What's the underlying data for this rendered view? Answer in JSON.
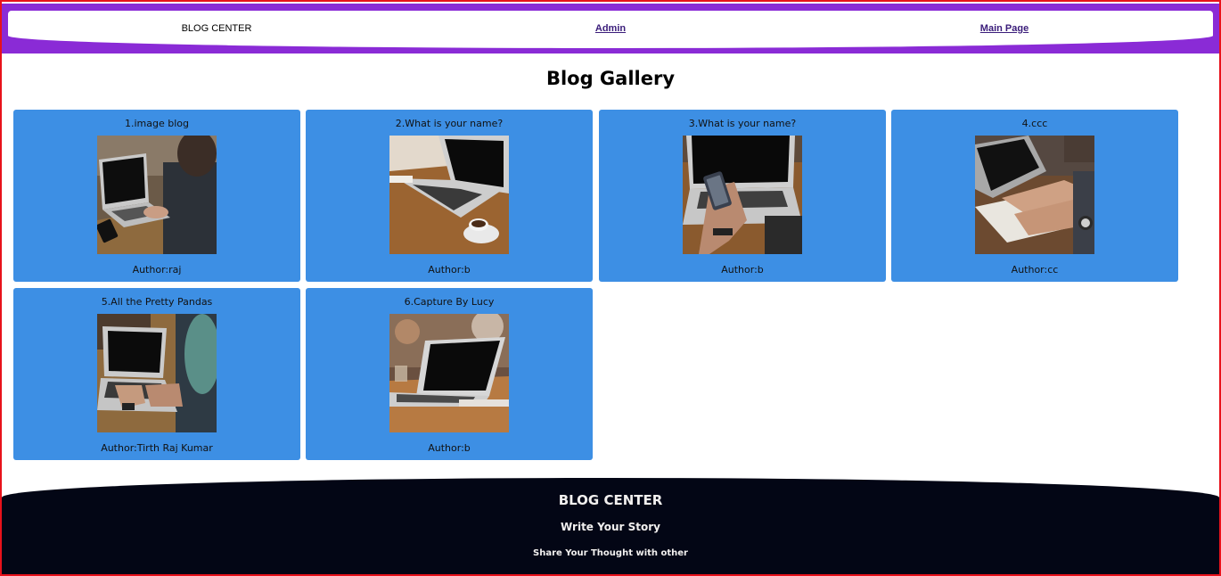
{
  "header": {
    "brand": "BLOG CENTER",
    "links": {
      "admin": "Admin",
      "main_page": "Main Page"
    },
    "colors": {
      "band": "#8a2bd6",
      "link": "#3a1c7a"
    }
  },
  "gallery": {
    "title": "Blog Gallery",
    "card_color": "#3d8fe4",
    "cards": [
      {
        "title": "1.image blog",
        "author": "Author:raj",
        "image": "laptop-typing-photo"
      },
      {
        "title": "2.What is your name?",
        "author": "Author:b",
        "image": "laptop-coffee-photo"
      },
      {
        "title": "3.What is your name?",
        "author": "Author:b",
        "image": "laptop-phone-photo"
      },
      {
        "title": "4.ccc",
        "author": "Author:cc",
        "image": "writing-notebook-photo"
      },
      {
        "title": "5.All the Pretty Pandas",
        "author": "Author:Tirth Raj Kumar",
        "image": "laptop-typing-photo"
      },
      {
        "title": "6.Capture By Lucy",
        "author": "Author:b",
        "image": "laptop-table-photo"
      }
    ]
  },
  "footer": {
    "title": "BLOG CENTER",
    "subtitle": "Write Your Story",
    "tagline": "Share Your Thought with other",
    "background": "#030615"
  }
}
